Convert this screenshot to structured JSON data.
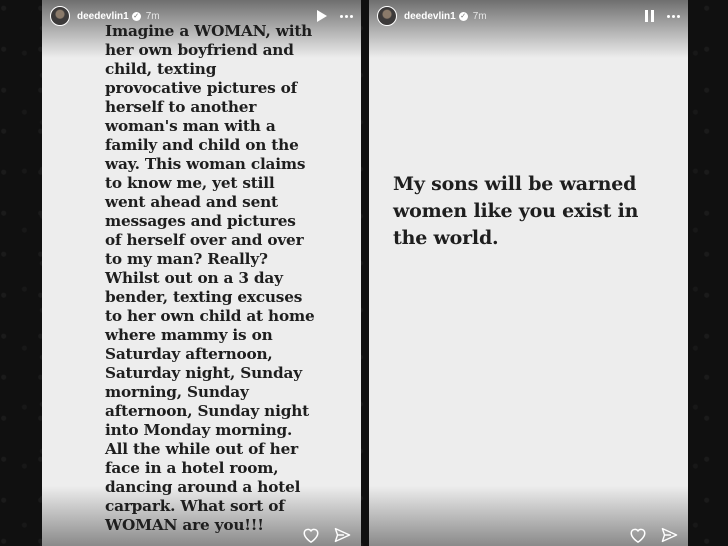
{
  "stories": [
    {
      "username": "deedevlin1",
      "time": "7m",
      "state": "paused",
      "text": "Imagine a WOMAN, with\nher own boyfriend and\nchild, texting\nprovocative pictures of\nherself to another\nwoman's man with a\nfamily and child on the\nway. This woman claims\nto know me, yet still\nwent ahead and sent\nmessages and pictures\nof herself over and over\nto my man? Really?\nWhilst out on a 3 day\nbender, texting excuses\nto her own child at home\nwhere mammy is on\nSaturday afternoon,\nSaturday night, Sunday\nmorning, Sunday\nafternoon, Sunday night\ninto Monday morning.\nAll the while out of her\nface in a hotel room,\ndancing around a hotel\ncarpark. What sort of\nWOMAN are you!!!"
    },
    {
      "username": "deedevlin1",
      "time": "7m",
      "state": "playing",
      "text": "My sons will be warned\nwomen like you exist in\nthe world."
    }
  ],
  "icons": {
    "verified": "verified-badge-icon",
    "play": "play-icon",
    "pause": "pause-icon",
    "more": "more-options-icon",
    "like": "heart-icon",
    "share": "send-icon"
  },
  "colors": {
    "story_background": "#ededed",
    "text": "#1e1e1e",
    "page_background": "#0e0e0e"
  }
}
